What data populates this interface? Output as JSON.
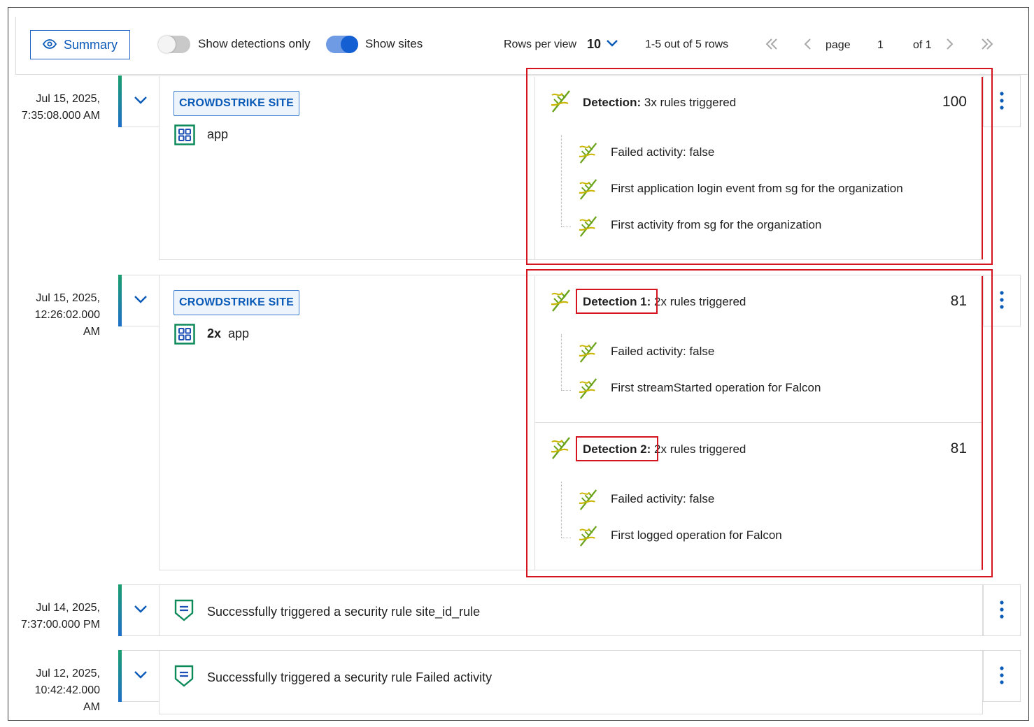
{
  "toolbar": {
    "summary_label": "Summary",
    "toggle_detections_label": "Show detections only",
    "toggle_detections_on": false,
    "toggle_sites_label": "Show sites",
    "toggle_sites_on": true,
    "rows_per_view_label": "Rows per view",
    "rows_per_view_value": "10",
    "range_text": "1-5 out of 5 rows",
    "page_label": "page",
    "page_value": "1",
    "page_of": "of 1",
    "accent_color": "#1460d2"
  },
  "rows": [
    {
      "date_line1": "Jul 15, 2025,",
      "date_line2": "7:35:08.000 AM",
      "badge": "CROWDSTRIKE SITE",
      "app": "app",
      "detection": {
        "label": "Detection:",
        "summary": "3x rules triggered",
        "score": "100",
        "rules": [
          "Failed activity: false",
          "First application login event from sg for the organization",
          "First activity from sg for the organization"
        ]
      }
    },
    {
      "date_line1": "Jul 15, 2025,",
      "date_line2": "12:26:02.000",
      "date_line3": "AM",
      "badge": "CROWDSTRIKE SITE",
      "app_count": "2x",
      "app": "app",
      "detections": [
        {
          "label": "Detection 1:",
          "summary": "2x rules triggered",
          "score": "81",
          "rules": [
            "Failed activity: false",
            "First streamStarted operation for Falcon"
          ]
        },
        {
          "label": "Detection 2:",
          "summary": "2x rules triggered",
          "score": "81",
          "rules": [
            "Failed activity: false",
            "First logged operation for Falcon"
          ]
        }
      ]
    },
    {
      "date_line1": "Jul 14, 2025,",
      "date_line2": "7:37:00.000 PM",
      "text": "Successfully triggered a security rule site_id_rule"
    },
    {
      "date_line1": "Jul 12, 2025,",
      "date_line2": "10:42:42.000",
      "date_line3": "AM",
      "text": "Successfully triggered a security rule Failed activity"
    }
  ],
  "highlight_color": "#d5141f"
}
